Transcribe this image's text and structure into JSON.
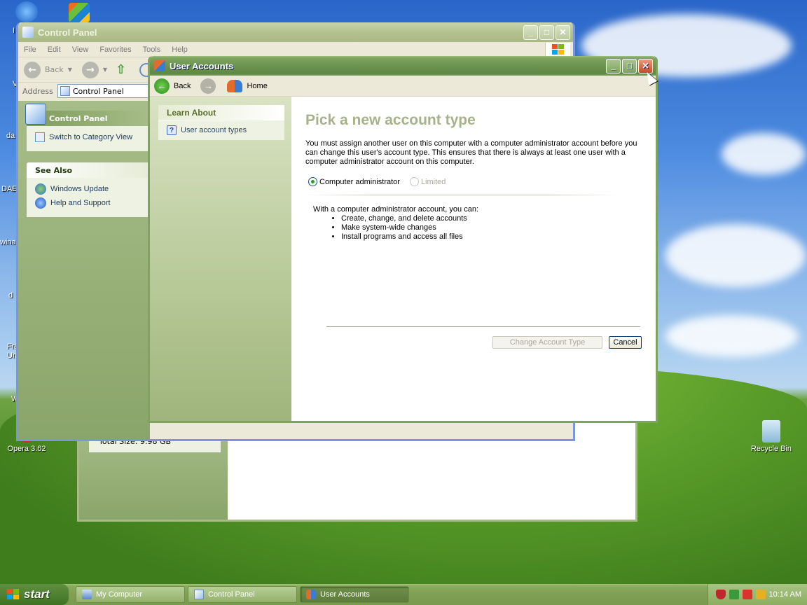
{
  "desktop": {
    "icons": [
      {
        "name": "opera-icon",
        "label": "Opera 3.62"
      },
      {
        "name": "recycle-bin-icon",
        "label": "Recycle Bin"
      }
    ],
    "edge_labels": [
      "I",
      "V",
      "da",
      "DAE",
      "wina",
      "d",
      "Fre",
      "Un",
      "W"
    ]
  },
  "behind_window": {
    "status_text": "Total Size: 9.98 GB"
  },
  "control_panel": {
    "title": "Control Panel",
    "menu": [
      "File",
      "Edit",
      "View",
      "Favorites",
      "Tools",
      "Help"
    ],
    "back_label": "Back",
    "address_label": "Address",
    "address_value": "Control Panel",
    "panel_title": "Control Panel",
    "switch_view": "Switch to Category View",
    "see_also_title": "See Also",
    "see_also": [
      "Windows Update",
      "Help and Support"
    ]
  },
  "user_accounts": {
    "title": "User Accounts",
    "nav": {
      "back": "Back",
      "home": "Home"
    },
    "learn_about_title": "Learn About",
    "learn_item": "User account types",
    "heading": "Pick a new account type",
    "description": "You must assign another user on this computer with a computer administrator account before you can change this user's account type. This ensures that there is always at least one user with a computer administrator account on this computer.",
    "radio_admin": "Computer administrator",
    "radio_limited": "Limited",
    "caps_intro": "With a computer administrator account, you can:",
    "caps": [
      "Create, change, and delete accounts",
      "Make system-wide changes",
      "Install programs and access all files"
    ],
    "change_button": "Change Account Type",
    "cancel_button": "Cancel"
  },
  "taskbar": {
    "start": "start",
    "tasks": [
      "My Computer",
      "Control Panel",
      "User Accounts"
    ],
    "clock": "10:14 AM"
  },
  "colors": {
    "title_green": "#6c9450",
    "heading_muted": "#a6b28a"
  }
}
